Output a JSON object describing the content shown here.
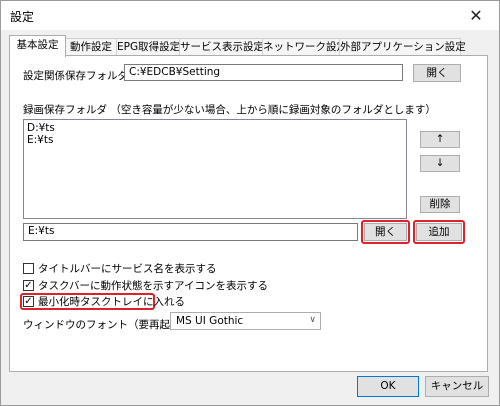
{
  "window": {
    "title": "設定",
    "close_glyph": "✕"
  },
  "tabs": [
    {
      "label": "基本設定"
    },
    {
      "label": "動作設定"
    },
    {
      "label": "EPG取得設定"
    },
    {
      "label": "サービス表示設定"
    },
    {
      "label": "ネットワーク設定"
    },
    {
      "label": "外部アプリケーション設定"
    }
  ],
  "settings_folder": {
    "label": "設定関係保存フォルダ",
    "value": "C:¥EDCB¥Setting",
    "open_label": "開く"
  },
  "record_folder": {
    "label": "録画保存フォルダ （空き容量が少ない場合、上から順に録画対象のフォルダとします）",
    "items": [
      "D:¥ts",
      "E:¥ts"
    ],
    "up_label": "↑",
    "down_label": "↓",
    "delete_label": "削除",
    "input_value": "E:¥ts",
    "open_label": "開く",
    "add_label": "追加"
  },
  "options": {
    "service_name_in_title": {
      "label": "タイトルバーにサービス名を表示する",
      "checked": false
    },
    "taskbar_icon": {
      "label": "タスクバーに動作状態を示すアイコンを表示する",
      "checked": true
    },
    "minimize_to_tray": {
      "label": "最小化時タスクトレイに入れる",
      "checked": true
    }
  },
  "font_setting": {
    "label": "ウィンドウのフォント（要再起動）",
    "value": "MS UI Gothic"
  },
  "footer": {
    "ok_label": "OK",
    "cancel_label": "キャンセル"
  },
  "colors": {
    "highlight": "#e0202a"
  }
}
